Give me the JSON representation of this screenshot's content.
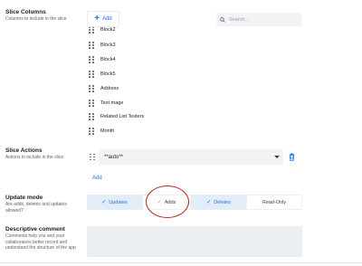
{
  "slice_columns": {
    "title": "Slice Columns",
    "description": "Columns to include in the slice",
    "add_label": "Add",
    "search_placeholder": "Search...",
    "items": [
      {
        "label": "Block2"
      },
      {
        "label": "Block3"
      },
      {
        "label": "Block4"
      },
      {
        "label": "Block5"
      },
      {
        "label": "Address"
      },
      {
        "label": "Test mage"
      },
      {
        "label": "Related List Testers"
      },
      {
        "label": "Month"
      }
    ]
  },
  "slice_actions": {
    "title": "Slice Actions",
    "description": "Actions to include in the slice",
    "selected_value": "**auto**",
    "add_label": "Add"
  },
  "update_mode": {
    "title": "Update mode",
    "description": "Are adds, deletes and updates allowed?",
    "options": [
      {
        "label": "Updates",
        "checked": true
      },
      {
        "label": "Adds",
        "checked": false
      },
      {
        "label": "Deletes",
        "checked": true
      },
      {
        "label": "Read-Only",
        "checked": false
      }
    ],
    "highlighted_option": "Adds"
  },
  "descriptive_comment": {
    "title": "Descriptive comment",
    "description": "Comments help you and your collaborators better record and understand the structure of the app",
    "value": ""
  },
  "colors": {
    "accent": "#1a73e8",
    "selected_bg": "#e3edf7",
    "annotation": "#b3261e"
  }
}
